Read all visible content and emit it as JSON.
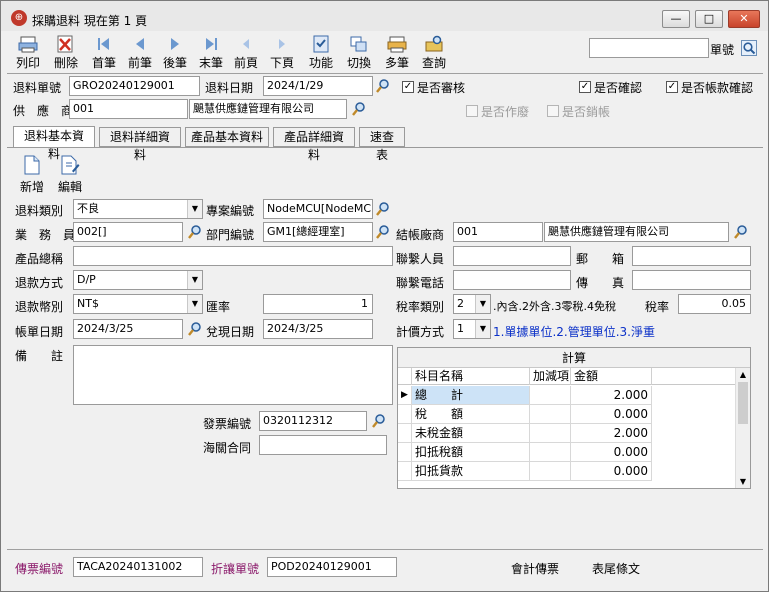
{
  "window": {
    "title": "採購退料  現在第 1 頁",
    "minimize": "—",
    "maximize": "□",
    "close": "✕"
  },
  "toolbar": {
    "items": [
      {
        "label": "列印",
        "icon": "printer-icon"
      },
      {
        "label": "刪除",
        "icon": "delete-icon"
      },
      {
        "label": "首筆",
        "icon": "first-record-icon"
      },
      {
        "label": "前筆",
        "icon": "prev-record-icon"
      },
      {
        "label": "後筆",
        "icon": "next-record-icon"
      },
      {
        "label": "末筆",
        "icon": "last-record-icon"
      },
      {
        "label": "前頁",
        "icon": "prev-page-icon"
      },
      {
        "label": "下頁",
        "icon": "next-page-icon"
      },
      {
        "label": "功能",
        "icon": "function-icon"
      },
      {
        "label": "切換",
        "icon": "switch-icon"
      },
      {
        "label": "多筆",
        "icon": "multi-record-icon"
      },
      {
        "label": "查詢",
        "icon": "query-icon"
      }
    ],
    "search_value": "",
    "search_label": "單號"
  },
  "header": {
    "return_no_label": "退料單號",
    "return_no": "GRO20240129001",
    "return_date_label": "退料日期",
    "return_date": "2024/1/29",
    "approved_label": "是否審核",
    "approved": true,
    "confirmed_label": "是否確認",
    "confirmed": true,
    "account_confirmed_label": "是否帳款確認",
    "account_confirmed": true,
    "supplier_label": "供　應　商",
    "supplier_code": "001",
    "supplier_name": "颶慧供應鏈管理有限公司",
    "voided_label": "是否作廢",
    "closed_label": "是否銷帳"
  },
  "tabs": [
    {
      "label": "退料基本資料",
      "active": true
    },
    {
      "label": "退料詳細資料",
      "active": false
    },
    {
      "label": "產品基本資料",
      "active": false
    },
    {
      "label": "產品詳細資料",
      "active": false
    },
    {
      "label": "速查表",
      "active": false
    }
  ],
  "subtoolbar": {
    "add_label": "新增",
    "edit_label": "編輯"
  },
  "form": {
    "return_type_label": "退料類別",
    "return_type": "不良",
    "project_no_label": "專案編號",
    "project_no": "NodeMCU[NodeMCU專",
    "salesperson_label": "業　務　員",
    "salesperson": "002[]",
    "department_label": "部門編號",
    "department": "GM1[總經理室]",
    "settlement_vendor_label": "結帳廠商",
    "settlement_vendor_code": "001",
    "settlement_vendor_name": "颶慧供應鏈管理有限公司",
    "product_summary_label": "產品總稱",
    "product_summary": "",
    "contact_label": "聯繫人員",
    "contact": "",
    "postal_label": "郵　　箱",
    "postal": "",
    "refund_method_label": "退款方式",
    "refund_method": "D/P",
    "contact_phone_label": "聯繫電話",
    "contact_phone": "",
    "fax_label": "傳　　真",
    "fax": "",
    "currency_label": "退款幣別",
    "currency": "NT$",
    "exchange_rate_label": "匯率",
    "exchange_rate": "1",
    "tax_type_label": "稅率類別",
    "tax_type": "2",
    "tax_type_hint": ".內含.2外含.3零稅.4免稅",
    "tax_rate_label": "稅率",
    "tax_rate": "0.05",
    "bill_date_label": "帳單日期",
    "bill_date": "2024/3/25",
    "cash_date_label": "兌現日期",
    "cash_date": "2024/3/25",
    "pricing_method_label": "計價方式",
    "pricing_method": "1",
    "pricing_method_hint": "1.單據單位.2.管理單位.3.淨重",
    "remarks_label": "備　　註",
    "remarks": "",
    "invoice_no_label": "發票編號",
    "invoice_no": "0320112312",
    "customs_contract_label": "海關合同",
    "customs_contract": ""
  },
  "calc_grid": {
    "title": "計算",
    "columns": [
      "科目名稱",
      "加減項",
      "金額"
    ],
    "rows": [
      {
        "name": "總　　計",
        "sign": "",
        "amount": "2.000"
      },
      {
        "name": "稅　　額",
        "sign": "",
        "amount": "0.000"
      },
      {
        "name": "未稅金額",
        "sign": "",
        "amount": "2.000"
      },
      {
        "name": "扣抵稅額",
        "sign": "",
        "amount": "0.000"
      },
      {
        "name": "扣抵貨款",
        "sign": "",
        "amount": "0.000"
      }
    ]
  },
  "footer": {
    "voucher_no_label": "傳票編號",
    "voucher_no": "TACA20240131002",
    "discount_no_label": "折讓單號",
    "discount_no": "POD20240129001",
    "accounting_voucher_label": "會計傳票",
    "footer_clause_label": "表尾條文"
  }
}
